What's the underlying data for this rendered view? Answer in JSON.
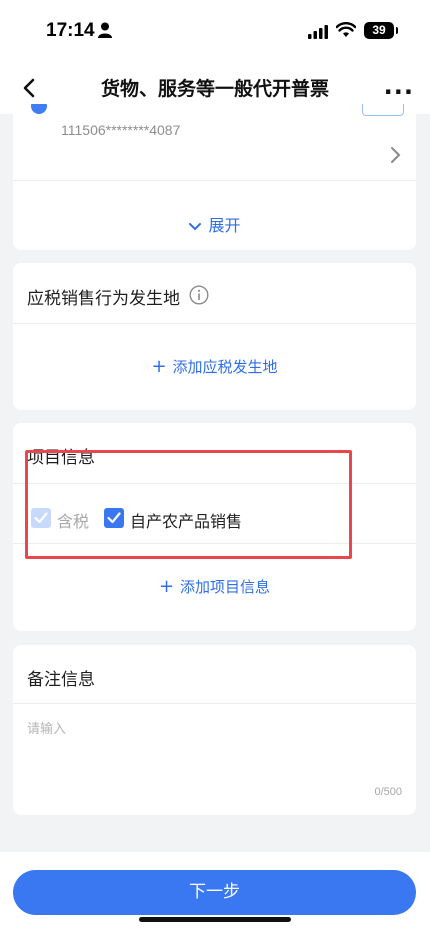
{
  "status_bar": {
    "time": "17:14",
    "battery": "39"
  },
  "nav": {
    "title": "货物、服务等一般代开普票",
    "more": "..."
  },
  "seller_card": {
    "account_masked": "111506********4087",
    "expand_label": "展开"
  },
  "location_card": {
    "title": "应税销售行为发生地",
    "add_label": "添加应税发生地"
  },
  "items_card": {
    "title": "项目信息",
    "tax_included_label": "含税",
    "agri_label": "自产农产品销售",
    "add_label": "添加项目信息",
    "tax_included_checked": true,
    "tax_included_disabled": true,
    "agri_checked": true
  },
  "remarks_card": {
    "title": "备注信息",
    "placeholder": "请输入",
    "counter": "0/500"
  },
  "footer": {
    "next_label": "下一步"
  },
  "colors": {
    "accent": "#3a78f2",
    "link": "#2f6fe6",
    "highlight": "#e8474d"
  }
}
